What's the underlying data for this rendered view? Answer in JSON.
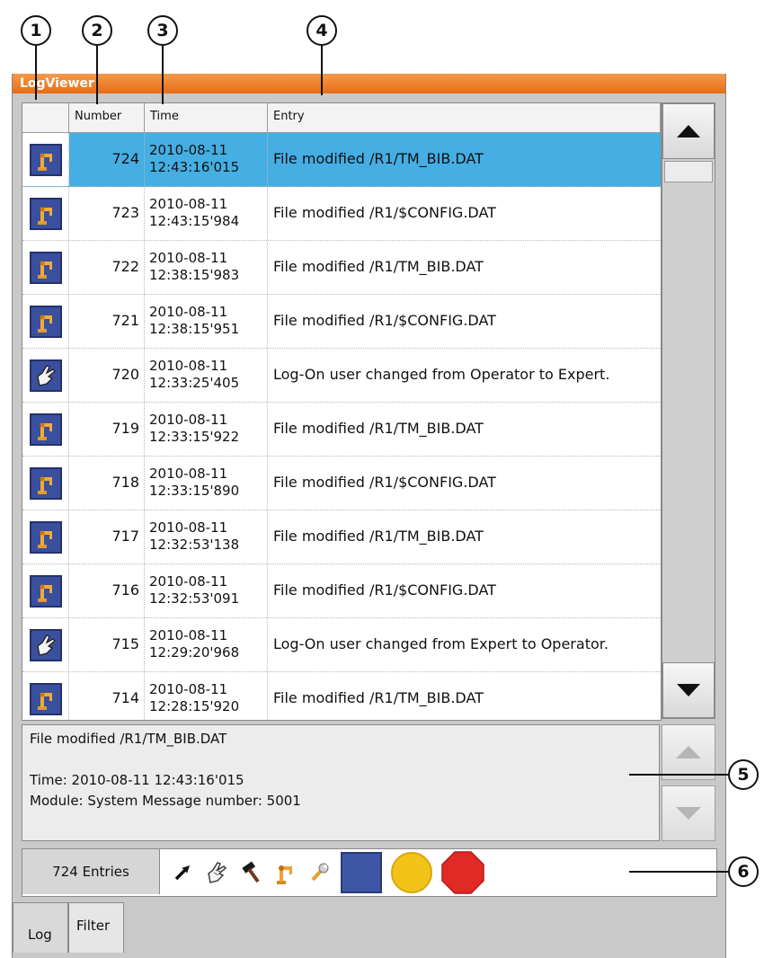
{
  "callouts": [
    "1",
    "2",
    "3",
    "4",
    "5",
    "6"
  ],
  "window": {
    "title": "LogViewer"
  },
  "table": {
    "headers": {
      "number": "Number",
      "time": "Time",
      "entry": "Entry"
    },
    "rows": [
      {
        "icon": "robot-icon",
        "number": "724",
        "date": "2010-08-11",
        "time": "12:43:16'015",
        "entry": "File modified /R1/TM_BIB.DAT",
        "selected": true
      },
      {
        "icon": "robot-icon",
        "number": "723",
        "date": "2010-08-11",
        "time": "12:43:15'984",
        "entry": "File modified /R1/$CONFIG.DAT"
      },
      {
        "icon": "robot-icon",
        "number": "722",
        "date": "2010-08-11",
        "time": "12:38:15'983",
        "entry": "File modified /R1/TM_BIB.DAT"
      },
      {
        "icon": "robot-icon",
        "number": "721",
        "date": "2010-08-11",
        "time": "12:38:15'951",
        "entry": "File modified /R1/$CONFIG.DAT"
      },
      {
        "icon": "hand-icon",
        "number": "720",
        "date": "2010-08-11",
        "time": "12:33:25'405",
        "entry": "Log-On user changed from Operator to Expert."
      },
      {
        "icon": "robot-icon",
        "number": "719",
        "date": "2010-08-11",
        "time": "12:33:15'922",
        "entry": "File modified /R1/TM_BIB.DAT"
      },
      {
        "icon": "robot-icon",
        "number": "718",
        "date": "2010-08-11",
        "time": "12:33:15'890",
        "entry": "File modified /R1/$CONFIG.DAT"
      },
      {
        "icon": "robot-icon",
        "number": "717",
        "date": "2010-08-11",
        "time": "12:32:53'138",
        "entry": "File modified /R1/TM_BIB.DAT"
      },
      {
        "icon": "robot-icon",
        "number": "716",
        "date": "2010-08-11",
        "time": "12:32:53'091",
        "entry": "File modified /R1/$CONFIG.DAT"
      },
      {
        "icon": "hand-icon",
        "number": "715",
        "date": "2010-08-11",
        "time": "12:29:20'968",
        "entry": "Log-On user changed from Expert to Operator."
      },
      {
        "icon": "robot-icon",
        "number": "714",
        "date": "2010-08-11",
        "time": "12:28:15'920",
        "entry": "File modified /R1/TM_BIB.DAT"
      }
    ]
  },
  "detail": {
    "line1": "File modified /R1/TM_BIB.DAT",
    "line2": "Time: 2010-08-11 12:43:16'015",
    "line3": "Module: System  Message number: 5001"
  },
  "status": {
    "count": "724 Entries"
  },
  "filter_icons": [
    "arrow-icon",
    "hand-icon",
    "hammer-icon",
    "robot-icon",
    "wrench-icon",
    "blue-square-icon",
    "yellow-circle-icon",
    "red-octagon-icon"
  ],
  "colors": {
    "title_bar": "#e8731c",
    "selection": "#45aee3",
    "icon_blue": "#3a4f9e",
    "yellow": "#f2c418",
    "red": "#e02a25"
  },
  "tabs": {
    "log": "Log",
    "filter": "Filter"
  }
}
